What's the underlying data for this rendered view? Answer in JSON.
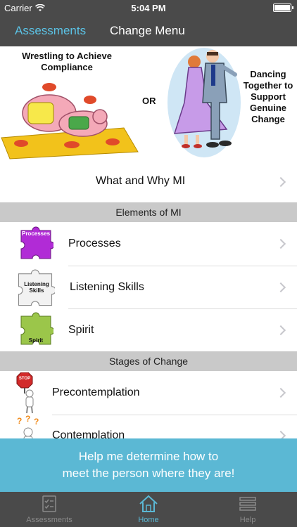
{
  "status_bar": {
    "carrier": "Carrier",
    "time": "5:04 PM"
  },
  "nav": {
    "assessments_label": "Assessments",
    "change_menu_label": "Change Menu"
  },
  "hero": {
    "left_caption": "Wrestling to Achieve Compliance",
    "or_label": "OR",
    "right_caption": "Dancing Together to Support Genuine Change"
  },
  "what_and_why": {
    "label": "What and Why MI"
  },
  "elements_section": {
    "header": "Elements of MI",
    "items": [
      {
        "label": "Processes",
        "icon_text": "Processes",
        "icon_color": "#b12bd6"
      },
      {
        "label": "Listening Skills",
        "icon_text": "Listening Skills",
        "icon_color": "#f2f2f2"
      },
      {
        "label": "Spirit",
        "icon_text": "Spirit",
        "icon_color": "#9bc64a"
      }
    ]
  },
  "stages_section": {
    "header": "Stages of Change",
    "items": [
      {
        "label": "Precontemplation",
        "icon_text": "STOP",
        "icon": "stop-sign-figure-icon"
      },
      {
        "label": "Contemplation",
        "icon": "question-marks-figure-icon"
      }
    ]
  },
  "cta": {
    "line1": "Help me determine how to",
    "line2": "meet the person where they are!"
  },
  "tab_bar": {
    "items": [
      {
        "label": "Assessments",
        "icon": "checklist-icon"
      },
      {
        "label": "Home",
        "icon": "home-icon"
      },
      {
        "label": "Help",
        "icon": "menu-lines-icon"
      }
    ]
  },
  "colors": {
    "accent": "#5bb8d4",
    "bar": "#4a4a4a",
    "section": "#c9c9c9"
  }
}
